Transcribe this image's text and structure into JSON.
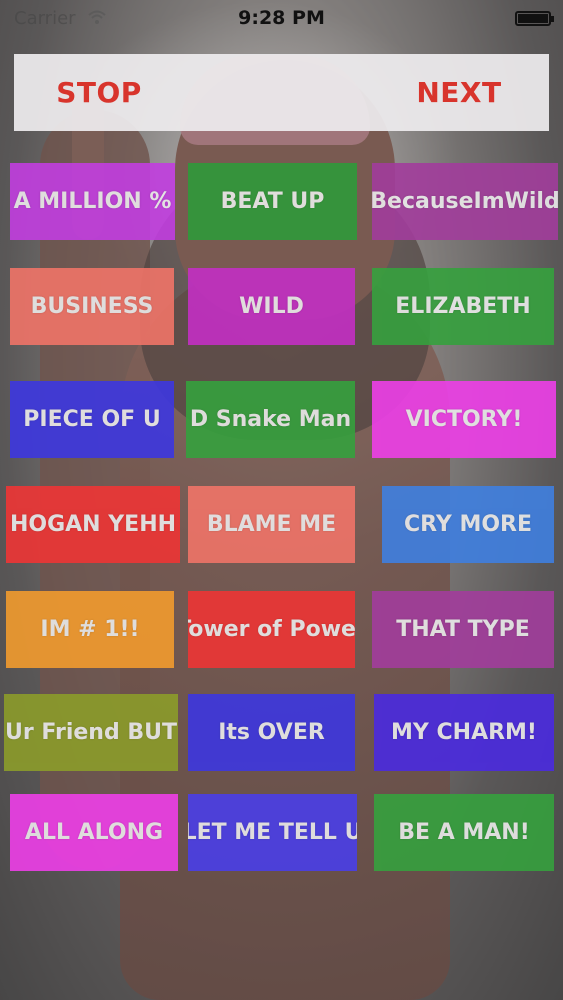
{
  "status_bar": {
    "carrier": "Carrier",
    "time": "9:28 PM",
    "wifi_icon": "wifi-icon",
    "battery_icon": "battery-icon"
  },
  "controls": {
    "stop_label": "STOP",
    "next_label": "NEXT",
    "text_color": "#d8342c"
  },
  "sound_buttons": [
    {
      "label": "A MILLION %",
      "color": "#c23ee0"
    },
    {
      "label": "BEAT UP",
      "color": "#2f9a3a"
    },
    {
      "label": "BecauseImWild",
      "color": "#a23d9c"
    },
    {
      "label": "BUSINESS",
      "color": "#f07468"
    },
    {
      "label": "WILD",
      "color": "#c32fc4"
    },
    {
      "label": "ELIZABETH",
      "color": "#36a13e"
    },
    {
      "label": "PIECE OF U",
      "color": "#3d37e0"
    },
    {
      "label": "D Snake Man",
      "color": "#36a13e"
    },
    {
      "label": "VICTORY!",
      "color": "#ee3fe8"
    },
    {
      "label": "HOGAN YEHH",
      "color": "#ee3535"
    },
    {
      "label": "BLAME ME",
      "color": "#f07468"
    },
    {
      "label": "CRY MORE",
      "color": "#3f7fe0"
    },
    {
      "label": "IM # 1!!",
      "color": "#f29b2e"
    },
    {
      "label": "Tower of Power",
      "color": "#ee3535"
    },
    {
      "label": "THAT TYPE",
      "color": "#a23d9c"
    },
    {
      "label": "Ur Friend BUT",
      "color": "#8c9c2a"
    },
    {
      "label": "Its OVER",
      "color": "#3d37e0"
    },
    {
      "label": "MY CHARM!",
      "color": "#4a2ae0"
    },
    {
      "label": "ALL ALONG",
      "color": "#ee3fe8"
    },
    {
      "label": "LET ME TELL U",
      "color": "#4a3fe8"
    },
    {
      "label": "BE A MAN!",
      "color": "#36a13e"
    }
  ]
}
